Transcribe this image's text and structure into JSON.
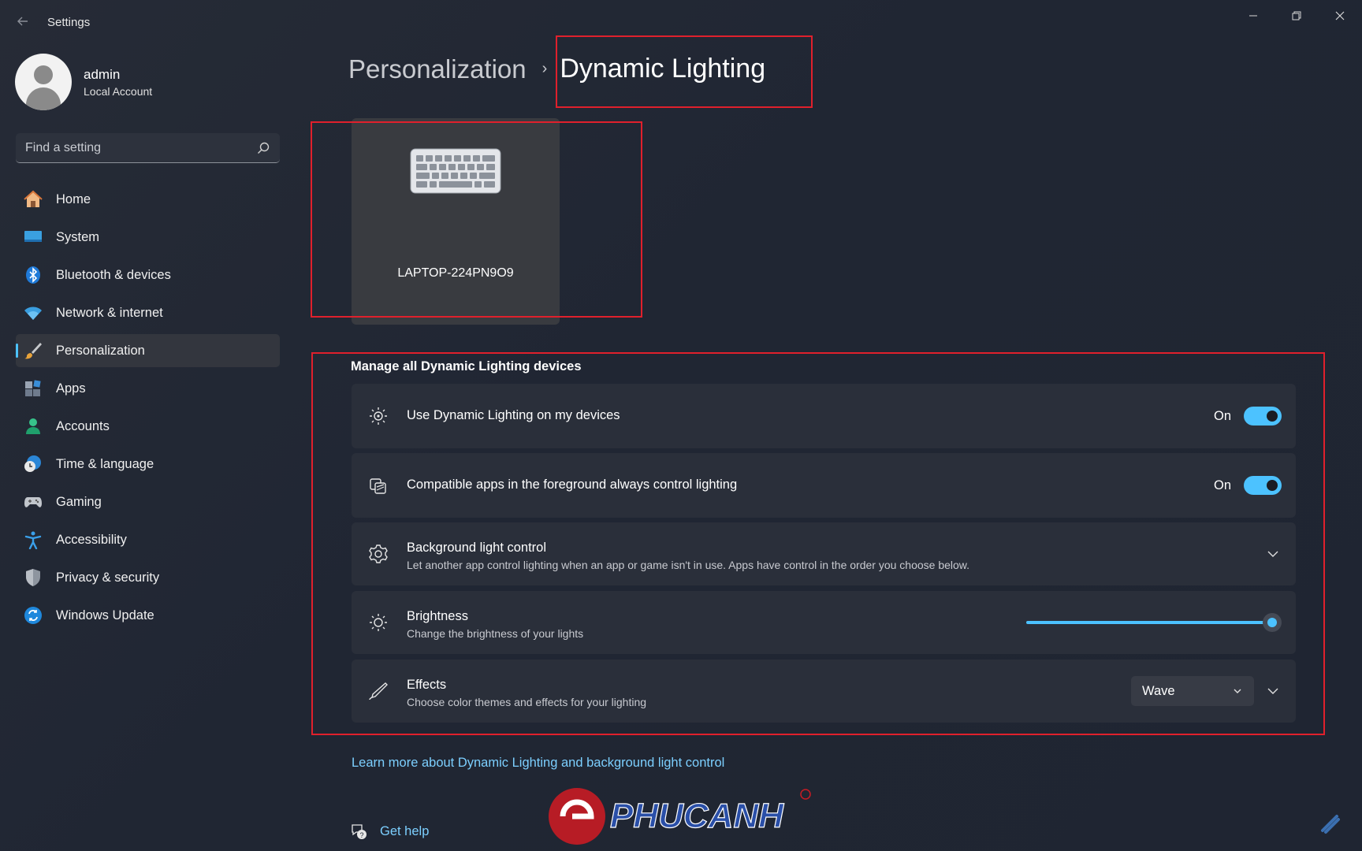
{
  "window": {
    "title": "Settings",
    "back_icon": "arrow-left-icon",
    "controls": [
      "minimize-icon",
      "restore-icon",
      "close-icon"
    ]
  },
  "user": {
    "name": "admin",
    "account_type": "Local Account"
  },
  "search": {
    "placeholder": "Find a setting",
    "icon": "search-icon"
  },
  "sidebar": {
    "items": [
      {
        "label": "Home",
        "icon": "home-icon",
        "active": false
      },
      {
        "label": "System",
        "icon": "monitor-icon",
        "active": false
      },
      {
        "label": "Bluetooth & devices",
        "icon": "bluetooth-icon",
        "active": false
      },
      {
        "label": "Network & internet",
        "icon": "wifi-icon",
        "active": false
      },
      {
        "label": "Personalization",
        "icon": "paintbrush-icon",
        "active": true
      },
      {
        "label": "Apps",
        "icon": "apps-icon",
        "active": false
      },
      {
        "label": "Accounts",
        "icon": "person-icon",
        "active": false
      },
      {
        "label": "Time & language",
        "icon": "clock-globe-icon",
        "active": false
      },
      {
        "label": "Gaming",
        "icon": "gamepad-icon",
        "active": false
      },
      {
        "label": "Accessibility",
        "icon": "accessibility-icon",
        "active": false
      },
      {
        "label": "Privacy & security",
        "icon": "shield-icon",
        "active": false
      },
      {
        "label": "Windows Update",
        "icon": "refresh-icon",
        "active": false
      }
    ]
  },
  "breadcrumb": {
    "parent": "Personalization",
    "separator": "›",
    "current": "Dynamic Lighting"
  },
  "device": {
    "name": "LAPTOP-224PN9O9",
    "icon": "keyboard-icon"
  },
  "section": {
    "title": "Manage all Dynamic Lighting devices"
  },
  "settings": {
    "use_dynamic": {
      "title": "Use Dynamic Lighting on my devices",
      "state_label": "On",
      "on": true,
      "icon": "sparkle-light-icon"
    },
    "compatible_apps": {
      "title": "Compatible apps in the foreground always control lighting",
      "state_label": "On",
      "on": true,
      "icon": "apps-lighting-icon"
    },
    "background": {
      "title": "Background light control",
      "desc": "Let another app control lighting when an app or game isn't in use. Apps have control in the order you choose below.",
      "icon": "gear-icon"
    },
    "brightness": {
      "title": "Brightness",
      "desc": "Change the brightness of your lights",
      "value_percent": 100,
      "icon": "sun-icon"
    },
    "effects": {
      "title": "Effects",
      "desc": "Choose color themes and effects for your lighting",
      "selected": "Wave",
      "icon": "pen-icon"
    }
  },
  "links": {
    "learn_more": "Learn more about Dynamic Lighting and background light control",
    "get_help": "Get help"
  },
  "colors": {
    "accent": "#4cc2ff",
    "highlight_box": "#e0202c",
    "background": "#202633",
    "card": "#2a2f3a"
  }
}
